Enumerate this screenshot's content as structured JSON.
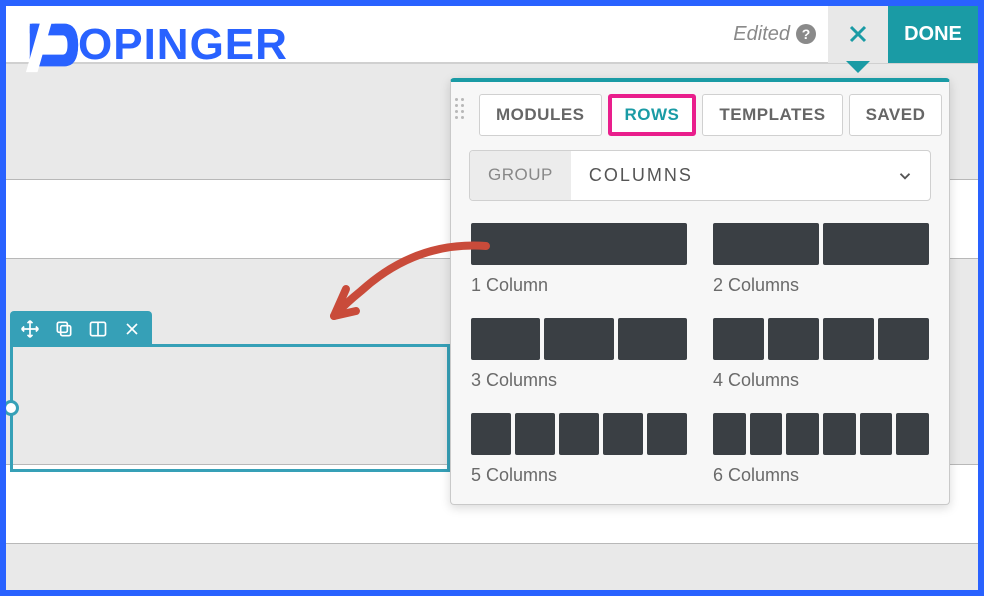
{
  "logo": {
    "text": "OPINGER"
  },
  "topbar": {
    "edited": "Edited",
    "done": "DONE"
  },
  "panel": {
    "tabs": [
      {
        "label": "MODULES",
        "active": false
      },
      {
        "label": "ROWS",
        "active": true
      },
      {
        "label": "TEMPLATES",
        "active": false
      },
      {
        "label": "SAVED",
        "active": false
      }
    ],
    "group": {
      "label": "GROUP",
      "value": "COLUMNS"
    },
    "layouts": [
      {
        "label": "1 Column",
        "cols": 1
      },
      {
        "label": "2 Columns",
        "cols": 2
      },
      {
        "label": "3 Columns",
        "cols": 3
      },
      {
        "label": "4 Columns",
        "cols": 4
      },
      {
        "label": "5 Columns",
        "cols": 5
      },
      {
        "label": "6 Columns",
        "cols": 6
      }
    ]
  },
  "colors": {
    "brand": "#2962ff",
    "accent": "#1a9ba5",
    "highlight": "#e91e8c",
    "arrow": "#c94b3a"
  }
}
